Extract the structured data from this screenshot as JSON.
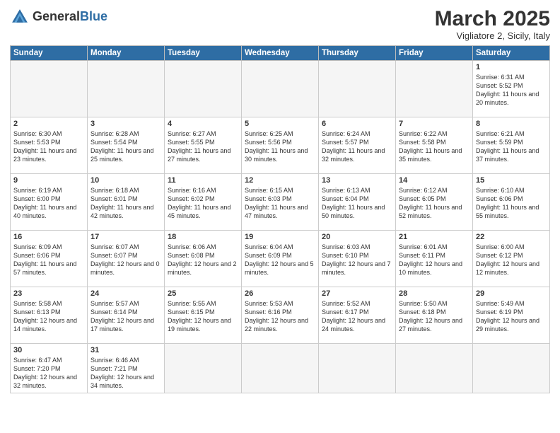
{
  "header": {
    "logo_general": "General",
    "logo_blue": "Blue",
    "month_title": "March 2025",
    "subtitle": "Vigliatore 2, Sicily, Italy"
  },
  "weekdays": [
    "Sunday",
    "Monday",
    "Tuesday",
    "Wednesday",
    "Thursday",
    "Friday",
    "Saturday"
  ],
  "weeks": [
    [
      {
        "day": "",
        "info": ""
      },
      {
        "day": "",
        "info": ""
      },
      {
        "day": "",
        "info": ""
      },
      {
        "day": "",
        "info": ""
      },
      {
        "day": "",
        "info": ""
      },
      {
        "day": "",
        "info": ""
      },
      {
        "day": "1",
        "info": "Sunrise: 6:31 AM\nSunset: 5:52 PM\nDaylight: 11 hours\nand 20 minutes."
      }
    ],
    [
      {
        "day": "2",
        "info": "Sunrise: 6:30 AM\nSunset: 5:53 PM\nDaylight: 11 hours\nand 23 minutes."
      },
      {
        "day": "3",
        "info": "Sunrise: 6:28 AM\nSunset: 5:54 PM\nDaylight: 11 hours\nand 25 minutes."
      },
      {
        "day": "4",
        "info": "Sunrise: 6:27 AM\nSunset: 5:55 PM\nDaylight: 11 hours\nand 27 minutes."
      },
      {
        "day": "5",
        "info": "Sunrise: 6:25 AM\nSunset: 5:56 PM\nDaylight: 11 hours\nand 30 minutes."
      },
      {
        "day": "6",
        "info": "Sunrise: 6:24 AM\nSunset: 5:57 PM\nDaylight: 11 hours\nand 32 minutes."
      },
      {
        "day": "7",
        "info": "Sunrise: 6:22 AM\nSunset: 5:58 PM\nDaylight: 11 hours\nand 35 minutes."
      },
      {
        "day": "8",
        "info": "Sunrise: 6:21 AM\nSunset: 5:59 PM\nDaylight: 11 hours\nand 37 minutes."
      }
    ],
    [
      {
        "day": "9",
        "info": "Sunrise: 6:19 AM\nSunset: 6:00 PM\nDaylight: 11 hours\nand 40 minutes."
      },
      {
        "day": "10",
        "info": "Sunrise: 6:18 AM\nSunset: 6:01 PM\nDaylight: 11 hours\nand 42 minutes."
      },
      {
        "day": "11",
        "info": "Sunrise: 6:16 AM\nSunset: 6:02 PM\nDaylight: 11 hours\nand 45 minutes."
      },
      {
        "day": "12",
        "info": "Sunrise: 6:15 AM\nSunset: 6:03 PM\nDaylight: 11 hours\nand 47 minutes."
      },
      {
        "day": "13",
        "info": "Sunrise: 6:13 AM\nSunset: 6:04 PM\nDaylight: 11 hours\nand 50 minutes."
      },
      {
        "day": "14",
        "info": "Sunrise: 6:12 AM\nSunset: 6:05 PM\nDaylight: 11 hours\nand 52 minutes."
      },
      {
        "day": "15",
        "info": "Sunrise: 6:10 AM\nSunset: 6:06 PM\nDaylight: 11 hours\nand 55 minutes."
      }
    ],
    [
      {
        "day": "16",
        "info": "Sunrise: 6:09 AM\nSunset: 6:06 PM\nDaylight: 11 hours\nand 57 minutes."
      },
      {
        "day": "17",
        "info": "Sunrise: 6:07 AM\nSunset: 6:07 PM\nDaylight: 12 hours\nand 0 minutes."
      },
      {
        "day": "18",
        "info": "Sunrise: 6:06 AM\nSunset: 6:08 PM\nDaylight: 12 hours\nand 2 minutes."
      },
      {
        "day": "19",
        "info": "Sunrise: 6:04 AM\nSunset: 6:09 PM\nDaylight: 12 hours\nand 5 minutes."
      },
      {
        "day": "20",
        "info": "Sunrise: 6:03 AM\nSunset: 6:10 PM\nDaylight: 12 hours\nand 7 minutes."
      },
      {
        "day": "21",
        "info": "Sunrise: 6:01 AM\nSunset: 6:11 PM\nDaylight: 12 hours\nand 10 minutes."
      },
      {
        "day": "22",
        "info": "Sunrise: 6:00 AM\nSunset: 6:12 PM\nDaylight: 12 hours\nand 12 minutes."
      }
    ],
    [
      {
        "day": "23",
        "info": "Sunrise: 5:58 AM\nSunset: 6:13 PM\nDaylight: 12 hours\nand 14 minutes."
      },
      {
        "day": "24",
        "info": "Sunrise: 5:57 AM\nSunset: 6:14 PM\nDaylight: 12 hours\nand 17 minutes."
      },
      {
        "day": "25",
        "info": "Sunrise: 5:55 AM\nSunset: 6:15 PM\nDaylight: 12 hours\nand 19 minutes."
      },
      {
        "day": "26",
        "info": "Sunrise: 5:53 AM\nSunset: 6:16 PM\nDaylight: 12 hours\nand 22 minutes."
      },
      {
        "day": "27",
        "info": "Sunrise: 5:52 AM\nSunset: 6:17 PM\nDaylight: 12 hours\nand 24 minutes."
      },
      {
        "day": "28",
        "info": "Sunrise: 5:50 AM\nSunset: 6:18 PM\nDaylight: 12 hours\nand 27 minutes."
      },
      {
        "day": "29",
        "info": "Sunrise: 5:49 AM\nSunset: 6:19 PM\nDaylight: 12 hours\nand 29 minutes."
      }
    ],
    [
      {
        "day": "30",
        "info": "Sunrise: 6:47 AM\nSunset: 7:20 PM\nDaylight: 12 hours\nand 32 minutes."
      },
      {
        "day": "31",
        "info": "Sunrise: 6:46 AM\nSunset: 7:21 PM\nDaylight: 12 hours\nand 34 minutes."
      },
      {
        "day": "",
        "info": ""
      },
      {
        "day": "",
        "info": ""
      },
      {
        "day": "",
        "info": ""
      },
      {
        "day": "",
        "info": ""
      },
      {
        "day": "",
        "info": ""
      }
    ]
  ]
}
